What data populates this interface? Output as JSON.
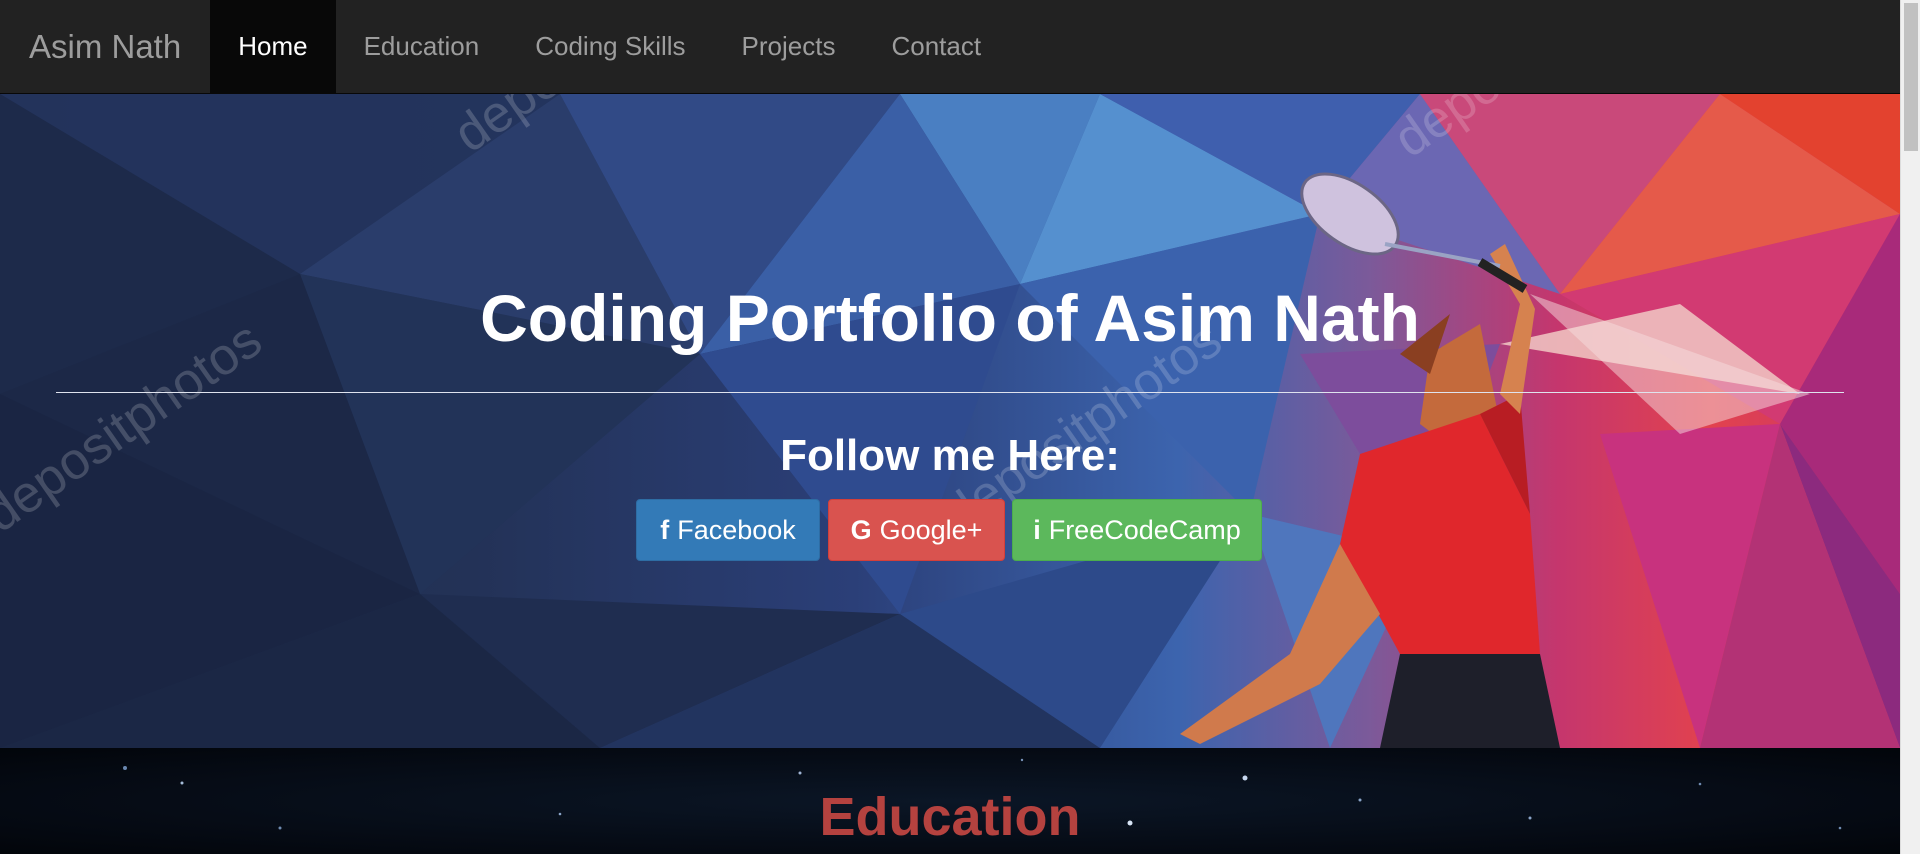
{
  "navbar": {
    "brand": "Asim Nath",
    "items": [
      {
        "label": "Home",
        "active": true
      },
      {
        "label": "Education",
        "active": false
      },
      {
        "label": "Coding Skills",
        "active": false
      },
      {
        "label": "Projects",
        "active": false
      },
      {
        "label": "Contact",
        "active": false
      }
    ]
  },
  "hero": {
    "title": "Coding Portfolio of Asim Nath",
    "follow_label": "Follow me Here:",
    "social": {
      "facebook": {
        "label": "Facebook",
        "icon": "facebook-icon",
        "color": "#337ab7"
      },
      "google": {
        "label": "Google+",
        "icon": "google-plus-icon",
        "color": "#d9534f"
      },
      "freecodecamp": {
        "label": "FreeCodeCamp",
        "icon": "info-icon",
        "color": "#5cb85c"
      }
    }
  },
  "education": {
    "title": "Education",
    "title_color": "#b5423f"
  }
}
